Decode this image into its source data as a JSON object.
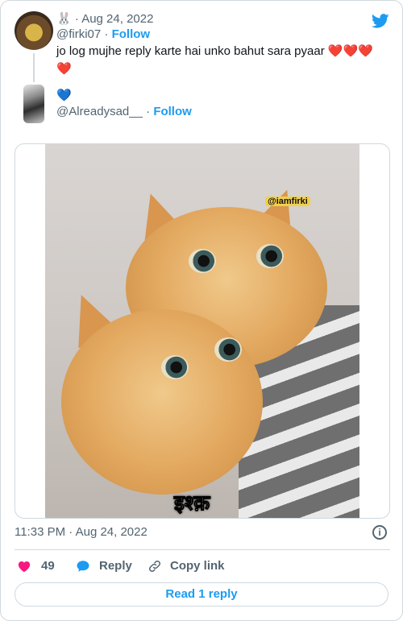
{
  "tweet": {
    "author": {
      "emoji": "🐰",
      "date": "Aug 24, 2022",
      "handle": "@firki07",
      "follow_label": "Follow"
    },
    "text": "jo log mujhe reply karte hai unko bahut sara pyaar",
    "hearts": "❤️❤️❤️",
    "hearts_line2": "❤️"
  },
  "reply": {
    "emoji": "💙",
    "handle": "@Alreadysad__",
    "follow_label": "Follow"
  },
  "media": {
    "watermark": "@iamfirki",
    "caption": "इश्क़"
  },
  "meta": {
    "timestamp": "11:33 PM · Aug 24, 2022"
  },
  "actions": {
    "like_count": "49",
    "reply_label": "Reply",
    "copy_link_label": "Copy link",
    "read_replies_label": "Read 1 reply"
  },
  "colors": {
    "accent": "#1d9bf0",
    "like": "#f91880",
    "muted": "#536471",
    "border": "#cfd9de"
  }
}
